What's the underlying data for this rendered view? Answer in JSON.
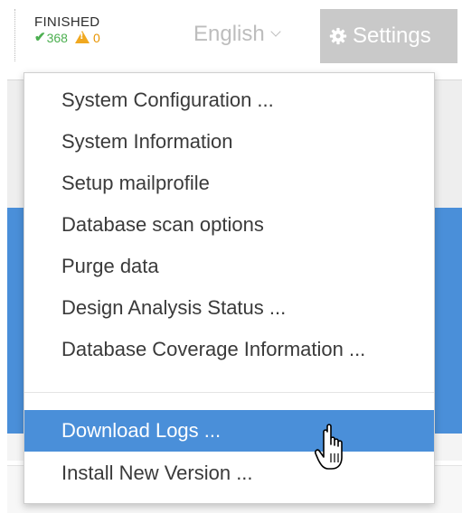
{
  "status": {
    "label": "FINISHED",
    "ok_count": "368",
    "warning_count": "0",
    "colors": {
      "ok": "#4caf50",
      "warning": "#f0a820"
    }
  },
  "language": {
    "selected": "English"
  },
  "settings": {
    "label": "Settings",
    "icon": "gear-icon"
  },
  "menu": {
    "items": [
      {
        "label": "System Configuration ..."
      },
      {
        "label": "System Information"
      },
      {
        "label": "Setup mailprofile"
      },
      {
        "label": "Database scan options"
      },
      {
        "label": "Purge data"
      },
      {
        "label": "Design Analysis Status ..."
      },
      {
        "label": "Database Coverage Information ..."
      },
      {
        "label": "Download Logs ...",
        "highlighted": true
      },
      {
        "label": "Install New Version ..."
      }
    ],
    "highlight_color": "#4a8fd9"
  }
}
